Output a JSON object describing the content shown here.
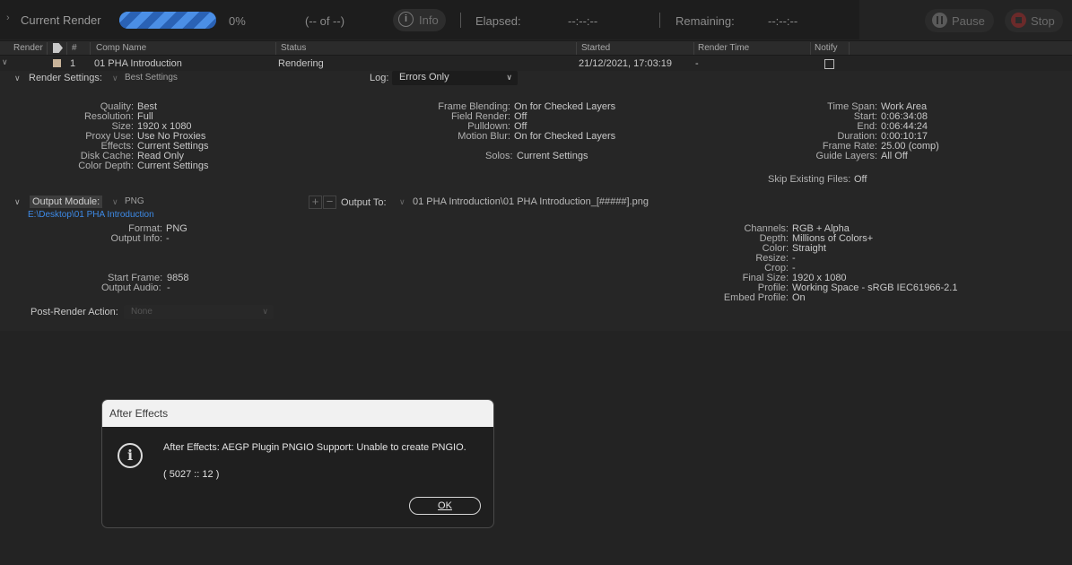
{
  "topbar": {
    "title": "Current Render",
    "progress_text": "0%",
    "progress_value": 0,
    "frames_text": "(-- of --)",
    "info_label": "Info",
    "elapsed_label": "Elapsed:",
    "elapsed_value": "--:--:--",
    "remaining_label": "Remaining:",
    "remaining_value": "--:--:--",
    "pause_label": "Pause",
    "stop_label": "Stop"
  },
  "table": {
    "headers": {
      "render": "Render",
      "number": "#",
      "comp_name": "Comp Name",
      "status": "Status",
      "started": "Started",
      "render_time": "Render Time",
      "notify": "Notify"
    },
    "row": {
      "number": "1",
      "comp_name": "01 PHA Introduction",
      "status": "Rendering",
      "started": "21/12/2021, 17:03:19",
      "render_time": "-"
    }
  },
  "render_settings": {
    "label": "Render Settings:",
    "preset": "Best Settings",
    "log_label": "Log:",
    "log_value": "Errors Only",
    "col1": [
      {
        "label": "Quality:",
        "value": "Best"
      },
      {
        "label": "Resolution:",
        "value": "Full"
      },
      {
        "label": "Size:",
        "value": "1920 x 1080"
      },
      {
        "label": "Proxy Use:",
        "value": "Use No Proxies"
      },
      {
        "label": "Effects:",
        "value": "Current Settings"
      },
      {
        "label": "Disk Cache:",
        "value": "Read Only"
      },
      {
        "label": "Color Depth:",
        "value": "Current Settings"
      }
    ],
    "col2": [
      {
        "label": "Frame Blending:",
        "value": "On for Checked Layers"
      },
      {
        "label": "Field Render:",
        "value": "Off"
      },
      {
        "label": "Pulldown:",
        "value": "Off"
      },
      {
        "label": "Motion Blur:",
        "value": "On for Checked Layers"
      }
    ],
    "solos_label": "Solos:",
    "solos_value": "Current Settings",
    "col3": [
      {
        "label": "Time Span:",
        "value": "Work Area"
      },
      {
        "label": "Start:",
        "value": "0:06:34:08"
      },
      {
        "label": "End:",
        "value": "0:06:44:24"
      },
      {
        "label": "Duration:",
        "value": "0:00:10:17"
      },
      {
        "label": "Frame Rate:",
        "value": "25.00 (comp)"
      },
      {
        "label": "Guide Layers:",
        "value": "All Off"
      }
    ],
    "skip_label": "Skip Existing Files:",
    "skip_value": "Off"
  },
  "output_module": {
    "label": "Output Module:",
    "preset": "PNG",
    "path": "E:\\Desktop\\01 PHA Introduction",
    "output_to_label": "Output To:",
    "output_to_value": "01 PHA Introduction\\01 PHA Introduction_[#####].png",
    "left": [
      {
        "label": "Format:",
        "value": "PNG"
      },
      {
        "label": "Output Info:",
        "value": "-"
      }
    ],
    "start_frame_label": "Start Frame:",
    "start_frame_value": "9858",
    "output_audio_label": "Output Audio:",
    "output_audio_value": "-",
    "right": [
      {
        "label": "Channels:",
        "value": "RGB + Alpha"
      },
      {
        "label": "Depth:",
        "value": "Millions of Colors+"
      },
      {
        "label": "Color:",
        "value": "Straight"
      },
      {
        "label": "Resize:",
        "value": "-"
      },
      {
        "label": "Crop:",
        "value": "-"
      },
      {
        "label": "Final Size:",
        "value": "1920 x 1080"
      },
      {
        "label": "Profile:",
        "value": "Working Space - sRGB IEC61966-2.1"
      },
      {
        "label": "Embed Profile:",
        "value": "On"
      }
    ],
    "post_render_label": "Post-Render Action:",
    "post_render_value": "None"
  },
  "dialog": {
    "title": "After Effects",
    "message": "After Effects: AEGP Plugin PNGIO Support: Unable to create PNGIO.",
    "code": "( 5027 :: 12 )",
    "ok_label": "OK"
  },
  "colors": {
    "accent_blue": "#2a6fc7",
    "link_blue": "#3d8ae6",
    "stop_red": "#c23434"
  },
  "icons": [
    "chevron-right-icon",
    "info-icon",
    "pause-icon",
    "stop-icon",
    "label-tag-icon",
    "chevron-down-icon",
    "plus-icon",
    "minus-icon"
  ]
}
